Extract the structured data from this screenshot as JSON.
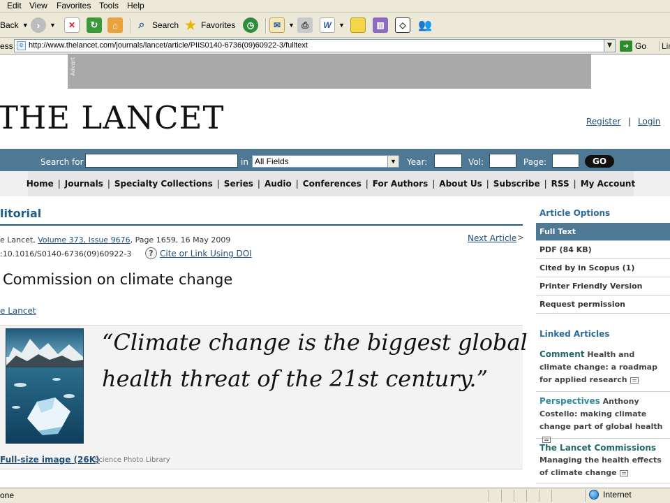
{
  "browser": {
    "menu": [
      "Edit",
      "View",
      "Favorites",
      "Tools",
      "Help"
    ],
    "toolbar": {
      "back_label": "Back",
      "search_label": "Search",
      "favorites_label": "Favorites"
    },
    "address": {
      "label": "ess",
      "url": "http://www.thelancet.com/journals/lancet/article/PIIS0140-6736(09)60922-3/fulltext",
      "go_label": "Go",
      "links_label": "Lin"
    },
    "status": {
      "text": "one",
      "zone": "Internet"
    }
  },
  "site": {
    "ad_label": "Advert",
    "logo": "THE LANCET",
    "register": "Register",
    "separator": "|",
    "login": "Login",
    "search": {
      "search_for": "Search for",
      "in": "in",
      "field_select": "All Fields",
      "year": "Year:",
      "vol": "Vol:",
      "page": "Page:",
      "go": "GO"
    },
    "nav": [
      "Home",
      "Journals",
      "Specialty Collections",
      "Series",
      "Audio",
      "Conferences",
      "For Authors",
      "About Us",
      "Subscribe",
      "RSS",
      "My Account"
    ]
  },
  "article": {
    "section": "litorial",
    "citation_prefix": "e Lancet, ",
    "volume_link": "Volume 373, Issue 9676",
    "citation_suffix": ", Page 1659, 16 May 2009",
    "next_article": "Next Article",
    "next_chevron": ">",
    "doi": ":10.1016/S0140-6736(09)60922-3",
    "cite_link": "Cite or Link Using DOI",
    "title": "Commission on climate change",
    "journal_link": "e Lancet",
    "quote": "“Climate change is the biggest global health threat of the 21st century.”",
    "fullsize_link": "Full-size image (26K)",
    "image_credit": "Science Photo Library"
  },
  "sidebar": {
    "options_heading": "Article Options",
    "options": [
      "Full Text",
      "PDF (84 KB)",
      "Cited by in Scopus (1)",
      "Printer Friendly Version",
      "Request permission"
    ],
    "linked_heading": "Linked Articles",
    "linked": [
      {
        "type": "Comment",
        "text": "Health and climate change: a roadmap for applied research"
      },
      {
        "type": "Perspectives",
        "text": "Anthony Costello: making climate change part of global health"
      },
      {
        "type": "The Lancet Commissions",
        "text": "Managing the health effects of climate change"
      }
    ]
  }
}
